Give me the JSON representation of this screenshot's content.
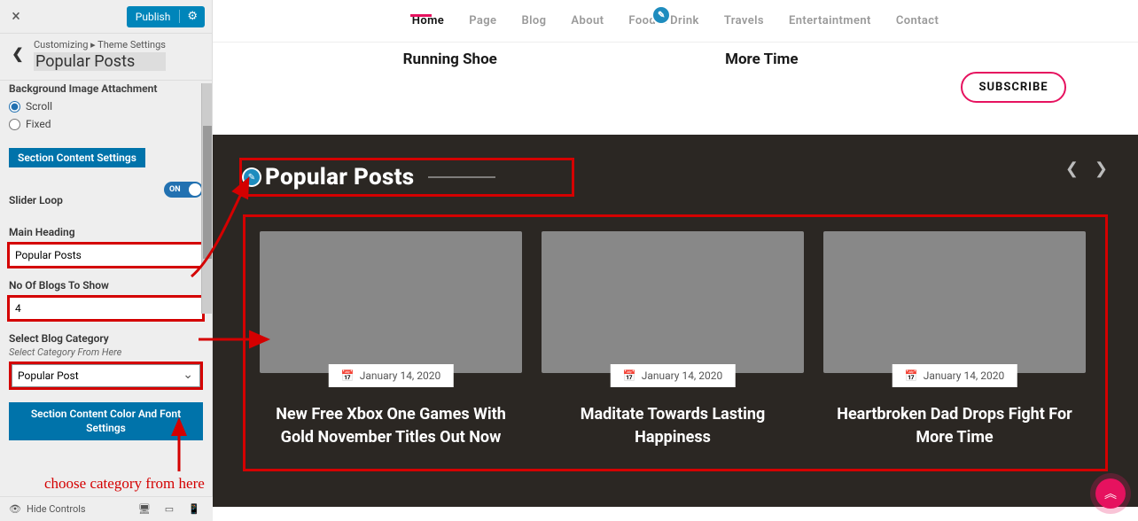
{
  "panel": {
    "publish_label": "Publish",
    "crumb1": "Customizing",
    "crumb2": "Theme Settings",
    "crumb_title": "Popular Posts",
    "bg_attach_label": "Background Image Attachment",
    "radio_scroll": "Scroll",
    "radio_fixed": "Fixed",
    "content_settings": "Section Content Settings",
    "slider_loop_label": "Slider Loop",
    "slider_loop_state": "ON",
    "main_heading_label": "Main Heading",
    "main_heading_value": "Popular Posts",
    "blogs_count_label": "No Of Blogs To Show",
    "blogs_count_value": "4",
    "category_label": "Select Blog Category",
    "category_sub": "Select Category From Here",
    "category_value": "Popular Post",
    "color_font_btn_l1": "Section Content Color And Font",
    "color_font_btn_l2": "Settings",
    "hide_controls": "Hide Controls"
  },
  "annotation": {
    "choose_category": "choose category from here"
  },
  "site": {
    "nav": {
      "home": "Home",
      "page": "Page",
      "blog": "Blog",
      "about": "About",
      "food": "Food & Drink",
      "travels": "Travels",
      "entertain": "Entertaintment",
      "contact": "Contact"
    },
    "subscribe": "SUBSCRIBE",
    "top_cards": {
      "c1": "Running Shoe",
      "c2": "More Time"
    },
    "popular_heading": "Popular Posts",
    "posts": [
      {
        "date": "January 14, 2020",
        "title": "New Free Xbox One Games With Gold November Titles Out Now"
      },
      {
        "date": "January 14, 2020",
        "title": "Maditate Towards Lasting Happiness"
      },
      {
        "date": "January 14, 2020",
        "title": "Heartbroken Dad Drops Fight For More Time"
      }
    ]
  },
  "colors": {
    "accent": "#e6125f",
    "hi": "#d40000",
    "wpblue": "#0073aa"
  }
}
